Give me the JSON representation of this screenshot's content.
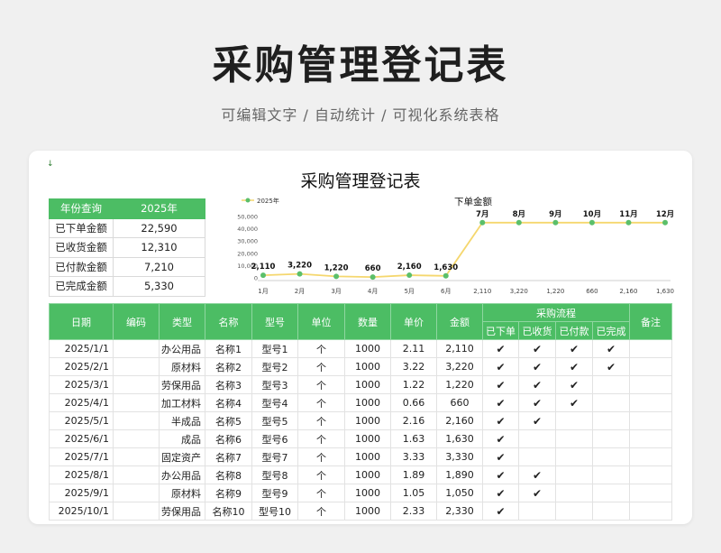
{
  "page": {
    "title": "采购管理登记表",
    "subtitle": "可编辑文字 / 自动统计 / 可视化系统表格"
  },
  "sheet": {
    "title": "采购管理登记表",
    "marker": "↓"
  },
  "summary": {
    "header": {
      "label": "年份查询",
      "value": "2025年"
    },
    "rows": [
      {
        "label": "已下单金额",
        "value": "22,590"
      },
      {
        "label": "已收货金额",
        "value": "12,310"
      },
      {
        "label": "已付款金额",
        "value": "7,210"
      },
      {
        "label": "已完成金额",
        "value": "5,330"
      }
    ]
  },
  "chart_data": {
    "type": "line",
    "legend": "2025年",
    "legend_position": "top-left",
    "y_ticks": [
      "50,000",
      "40,000",
      "30,000",
      "20,000",
      "10,000",
      "0"
    ],
    "ylim": [
      0,
      50000
    ],
    "categories": [
      "1月",
      "2月",
      "3月",
      "4月",
      "5月",
      "6月"
    ],
    "x_values": [
      "2,110",
      "3,220",
      "1,220",
      "660",
      "2,160",
      "1,630"
    ],
    "series": [
      {
        "name": "2025年",
        "values": [
          2110,
          3220,
          1220,
          660,
          2160,
          1630,
          45000,
          45000,
          45000,
          45000,
          45000,
          45000
        ],
        "labels": [
          "2,110",
          "3,220",
          "1,220",
          "660",
          "2,160",
          "1,630",
          "7月",
          "8月",
          "9月",
          "10月",
          "11月",
          "12月"
        ]
      }
    ],
    "annotation": "下单金额",
    "colors": {
      "line": "#f5d76e",
      "point": "#5bbf6a"
    }
  },
  "table": {
    "headers": {
      "date": "日期",
      "code": "编码",
      "type": "类型",
      "name": "名称",
      "model": "型号",
      "unit": "单位",
      "qty": "数量",
      "price": "单价",
      "amount": "金额",
      "process": "采购流程",
      "note": "备注",
      "steps": [
        "已下单",
        "已收货",
        "已付款",
        "已完成"
      ]
    },
    "rows": [
      {
        "date": "2025/1/1",
        "code": "",
        "type": "办公用品",
        "name": "名称1",
        "model": "型号1",
        "unit": "个",
        "qty": "1000",
        "price": "2.11",
        "amount": "2,110",
        "s1": "✔",
        "s2": "✔",
        "s3": "✔",
        "s4": "✔",
        "note": ""
      },
      {
        "date": "2025/2/1",
        "code": "",
        "type": "原材料",
        "name": "名称2",
        "model": "型号2",
        "unit": "个",
        "qty": "1000",
        "price": "3.22",
        "amount": "3,220",
        "s1": "✔",
        "s2": "✔",
        "s3": "✔",
        "s4": "✔",
        "note": ""
      },
      {
        "date": "2025/3/1",
        "code": "",
        "type": "劳保用品",
        "name": "名称3",
        "model": "型号3",
        "unit": "个",
        "qty": "1000",
        "price": "1.22",
        "amount": "1,220",
        "s1": "✔",
        "s2": "✔",
        "s3": "✔",
        "s4": "",
        "note": ""
      },
      {
        "date": "2025/4/1",
        "code": "",
        "type": "加工材料",
        "name": "名称4",
        "model": "型号4",
        "unit": "个",
        "qty": "1000",
        "price": "0.66",
        "amount": "660",
        "s1": "✔",
        "s2": "✔",
        "s3": "✔",
        "s4": "",
        "note": ""
      },
      {
        "date": "2025/5/1",
        "code": "",
        "type": "半成品",
        "name": "名称5",
        "model": "型号5",
        "unit": "个",
        "qty": "1000",
        "price": "2.16",
        "amount": "2,160",
        "s1": "✔",
        "s2": "✔",
        "s3": "",
        "s4": "",
        "note": ""
      },
      {
        "date": "2025/6/1",
        "code": "",
        "type": "成品",
        "name": "名称6",
        "model": "型号6",
        "unit": "个",
        "qty": "1000",
        "price": "1.63",
        "amount": "1,630",
        "s1": "✔",
        "s2": "",
        "s3": "",
        "s4": "",
        "note": ""
      },
      {
        "date": "2025/7/1",
        "code": "",
        "type": "固定资产",
        "name": "名称7",
        "model": "型号7",
        "unit": "个",
        "qty": "1000",
        "price": "3.33",
        "amount": "3,330",
        "s1": "✔",
        "s2": "",
        "s3": "",
        "s4": "",
        "note": ""
      },
      {
        "date": "2025/8/1",
        "code": "",
        "type": "办公用品",
        "name": "名称8",
        "model": "型号8",
        "unit": "个",
        "qty": "1000",
        "price": "1.89",
        "amount": "1,890",
        "s1": "✔",
        "s2": "✔",
        "s3": "",
        "s4": "",
        "note": ""
      },
      {
        "date": "2025/9/1",
        "code": "",
        "type": "原材料",
        "name": "名称9",
        "model": "型号9",
        "unit": "个",
        "qty": "1000",
        "price": "1.05",
        "amount": "1,050",
        "s1": "✔",
        "s2": "✔",
        "s3": "",
        "s4": "",
        "note": ""
      },
      {
        "date": "2025/10/1",
        "code": "",
        "type": "劳保用品",
        "name": "名称10",
        "model": "型号10",
        "unit": "个",
        "qty": "1000",
        "price": "2.33",
        "amount": "2,330",
        "s1": "✔",
        "s2": "",
        "s3": "",
        "s4": "",
        "note": ""
      }
    ]
  }
}
